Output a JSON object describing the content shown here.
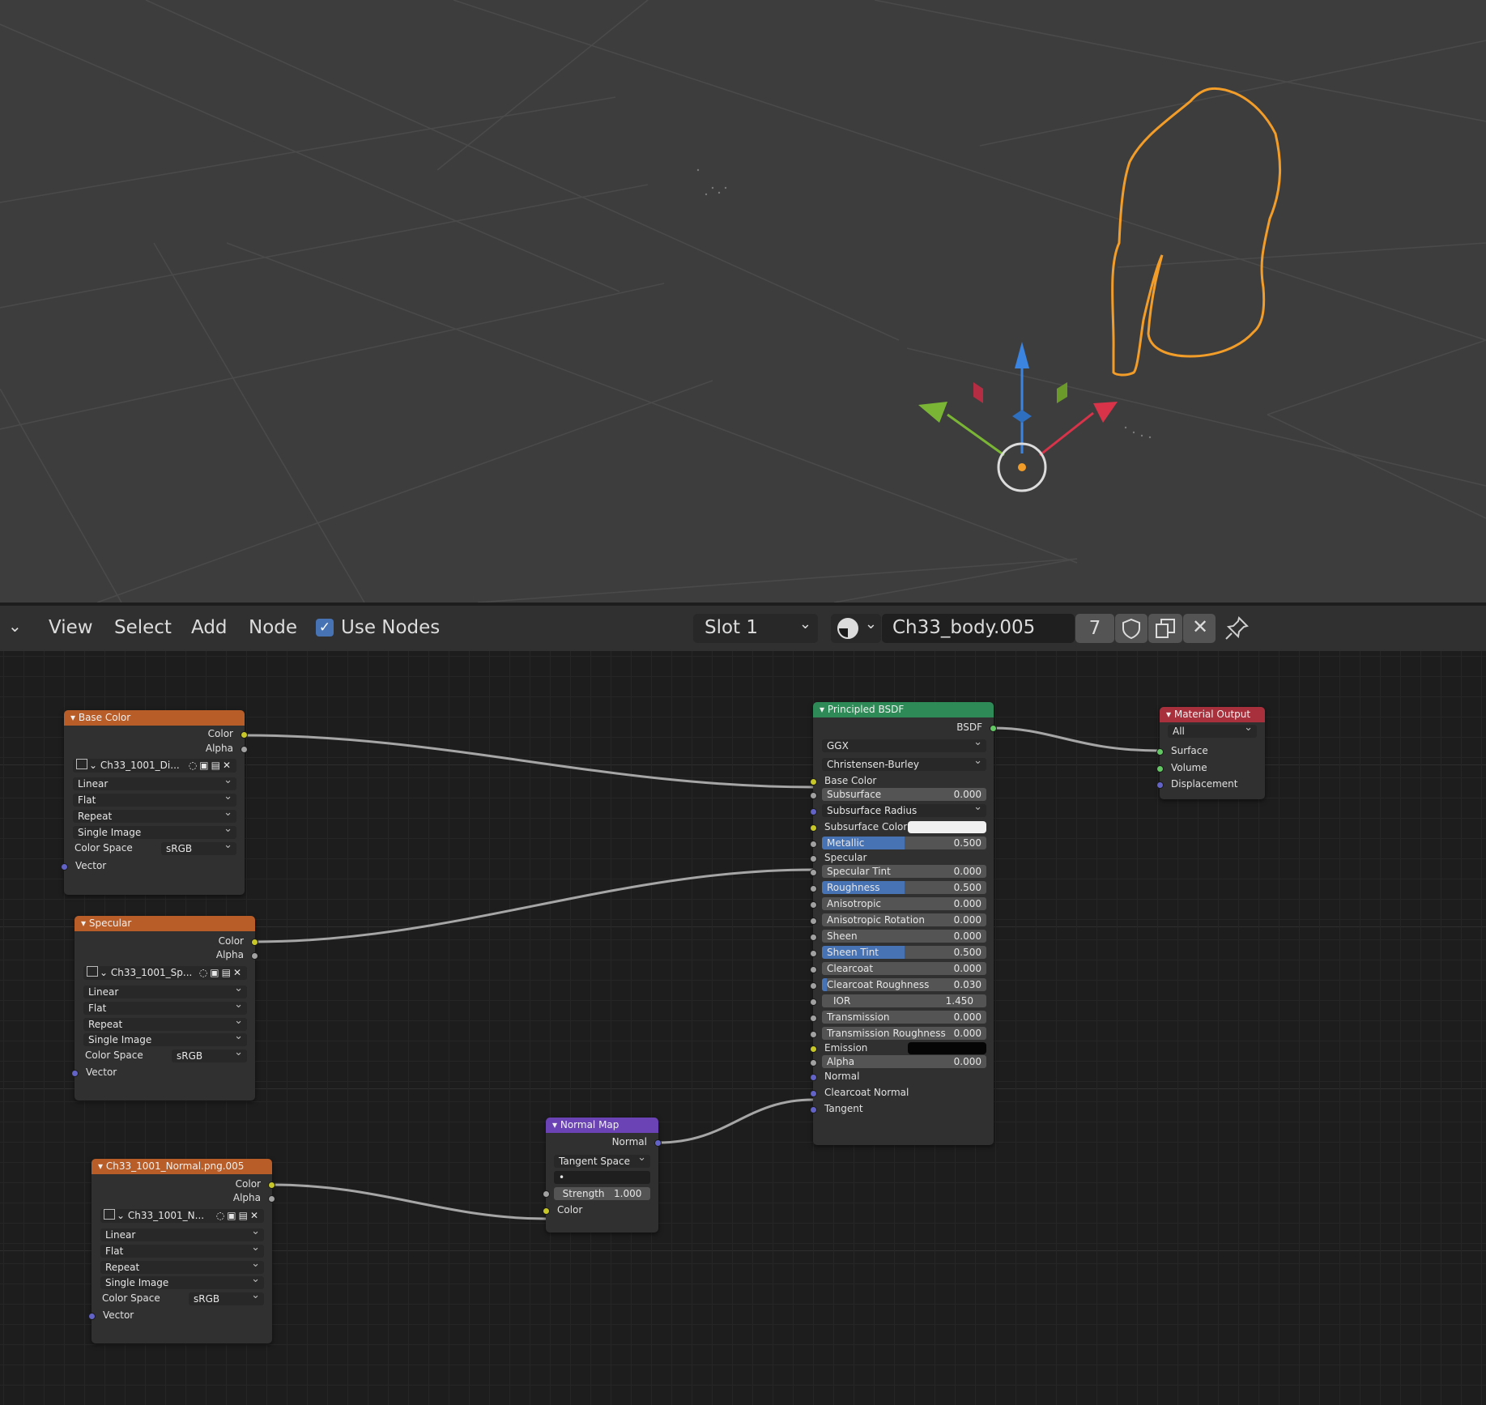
{
  "header": {
    "menu": {
      "view": "View",
      "select": "Select",
      "add": "Add",
      "node": "Node"
    },
    "use_nodes": "Use Nodes",
    "slot": "Slot 1",
    "material_name": "Ch33_body.005",
    "user_count": "7"
  },
  "nodes": {
    "base_color": {
      "title": "Base Color",
      "out_color": "Color",
      "out_alpha": "Alpha",
      "image": "Ch33_1001_Di...",
      "interp": "Linear",
      "proj": "Flat",
      "ext": "Repeat",
      "source": "Single Image",
      "cs_label": "Color Space",
      "cs_value": "sRGB",
      "in_vector": "Vector"
    },
    "specular": {
      "title": "Specular",
      "out_color": "Color",
      "out_alpha": "Alpha",
      "image": "Ch33_1001_Sp...",
      "interp": "Linear",
      "proj": "Flat",
      "ext": "Repeat",
      "source": "Single Image",
      "cs_label": "Color Space",
      "cs_value": "sRGB",
      "in_vector": "Vector"
    },
    "normal_tex": {
      "title": "Ch33_1001_Normal.png.005",
      "out_color": "Color",
      "out_alpha": "Alpha",
      "image": "Ch33_1001_N...",
      "interp": "Linear",
      "proj": "Flat",
      "ext": "Repeat",
      "source": "Single Image",
      "cs_label": "Color Space",
      "cs_value": "sRGB",
      "in_vector": "Vector"
    },
    "normal_map": {
      "title": "Normal Map",
      "out_normal": "Normal",
      "space": "Tangent Space",
      "uv": "•",
      "strength_label": "Strength",
      "strength": "1.000",
      "in_color": "Color"
    },
    "bsdf": {
      "title": "Principled BSDF",
      "out": "BSDF",
      "distribution": "GGX",
      "subsurface_method": "Christensen-Burley",
      "base_color": "Base Color",
      "subsurface": {
        "label": "Subsurface",
        "value": "0.000",
        "fill": 0
      },
      "subsurface_radius": "Subsurface Radius",
      "subsurface_color": "Subsurface Color",
      "metallic": {
        "label": "Metallic",
        "value": "0.500",
        "fill": 0.5
      },
      "specular": "Specular",
      "specular_tint": {
        "label": "Specular Tint",
        "value": "0.000",
        "fill": 0
      },
      "roughness": {
        "label": "Roughness",
        "value": "0.500",
        "fill": 0.5
      },
      "anisotropic": {
        "label": "Anisotropic",
        "value": "0.000",
        "fill": 0
      },
      "anisotropic_rotation": {
        "label": "Anisotropic Rotation",
        "value": "0.000",
        "fill": 0
      },
      "sheen": {
        "label": "Sheen",
        "value": "0.000",
        "fill": 0
      },
      "sheen_tint": {
        "label": "Sheen Tint",
        "value": "0.500",
        "fill": 0.5
      },
      "clearcoat": {
        "label": "Clearcoat",
        "value": "0.000",
        "fill": 0
      },
      "clearcoat_roughness": {
        "label": "Clearcoat Roughness",
        "value": "0.030",
        "fill": 0.03
      },
      "ior": {
        "label": "IOR",
        "value": "1.450"
      },
      "transmission": {
        "label": "Transmission",
        "value": "0.000",
        "fill": 0
      },
      "transmission_roughness": {
        "label": "Transmission Roughness",
        "value": "0.000",
        "fill": 0
      },
      "emission": "Emission",
      "alpha": {
        "label": "Alpha",
        "value": "0.000"
      },
      "normal": "Normal",
      "clearcoat_normal": "Clearcoat Normal",
      "tangent": "Tangent"
    },
    "output": {
      "title": "Material Output",
      "target": "All",
      "surface": "Surface",
      "volume": "Volume",
      "displacement": "Displacement"
    }
  },
  "colors": {
    "texture_header": "#b85c28",
    "shader_header": "#2e8b57",
    "vector_header": "#6b43b5",
    "output_header": "#a8303c",
    "socket_color": "#c7c729",
    "socket_float": "#a1a1a1",
    "socket_vector": "#6363c7",
    "socket_shader": "#63c763",
    "selection": "#f29d29"
  }
}
